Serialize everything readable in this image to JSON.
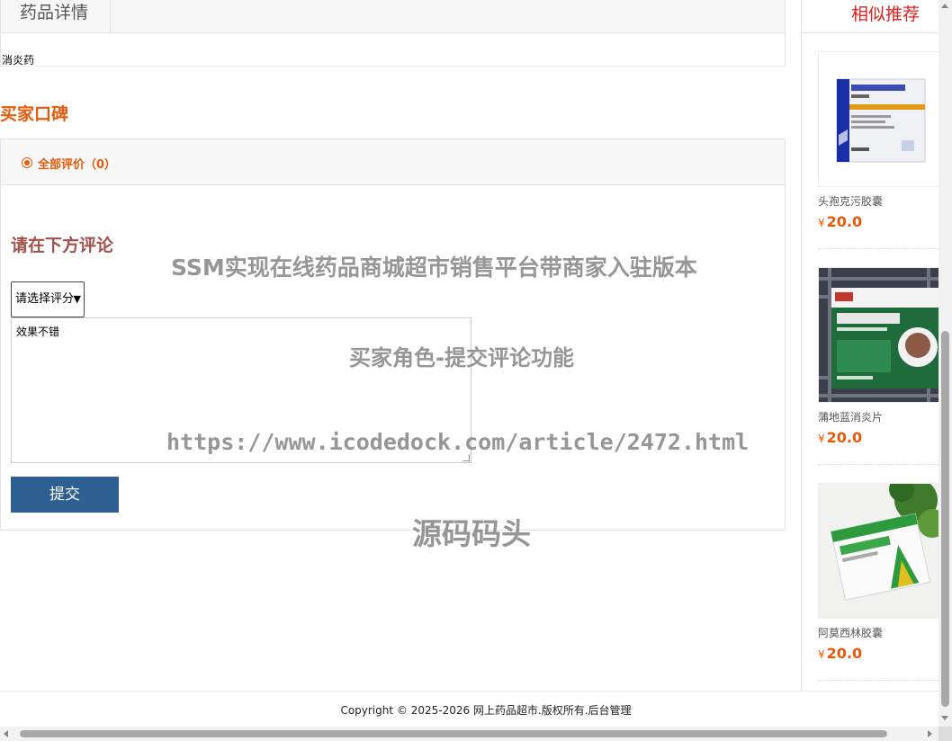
{
  "tabs": {
    "active_label": "药品详情"
  },
  "description": {
    "text": "消炎药"
  },
  "reviews": {
    "title": "买家口碑",
    "filter_label": "全部评价（0）"
  },
  "comment_form": {
    "title": "请在下方评论",
    "score_select_value": "请选择评分",
    "textarea_value": "效果不错",
    "submit_label": "提交"
  },
  "sidebar": {
    "title": "相似推荐",
    "items": [
      {
        "name": "头孢克污胶囊",
        "currency": "¥",
        "price": "20.0",
        "image": "cefaclor-capsule-box"
      },
      {
        "name": "蒲地蓝消炎片",
        "currency": "¥",
        "price": "20.0",
        "image": "pudilan-tablet-box"
      },
      {
        "name": "阿莫西林胶囊",
        "currency": "¥",
        "price": "20.0",
        "image": "amoxicillin-capsule-box"
      }
    ]
  },
  "watermark": {
    "line1": "SSM实现在线药品商城超市销售平台带商家入驻版本",
    "line2": "买家角色-提交评论功能",
    "line3": "https://www.icodedock.com/article/2472.html",
    "line4": "源码码头"
  },
  "footer": {
    "text": "Copyright © 2025-2026 网上药品超市.版权所有.后台管理"
  },
  "colors": {
    "accent": "#e8590c",
    "submit_bg": "#2e5f93",
    "sidebar_title": "#e02020",
    "comment_title": "#a0524c"
  }
}
